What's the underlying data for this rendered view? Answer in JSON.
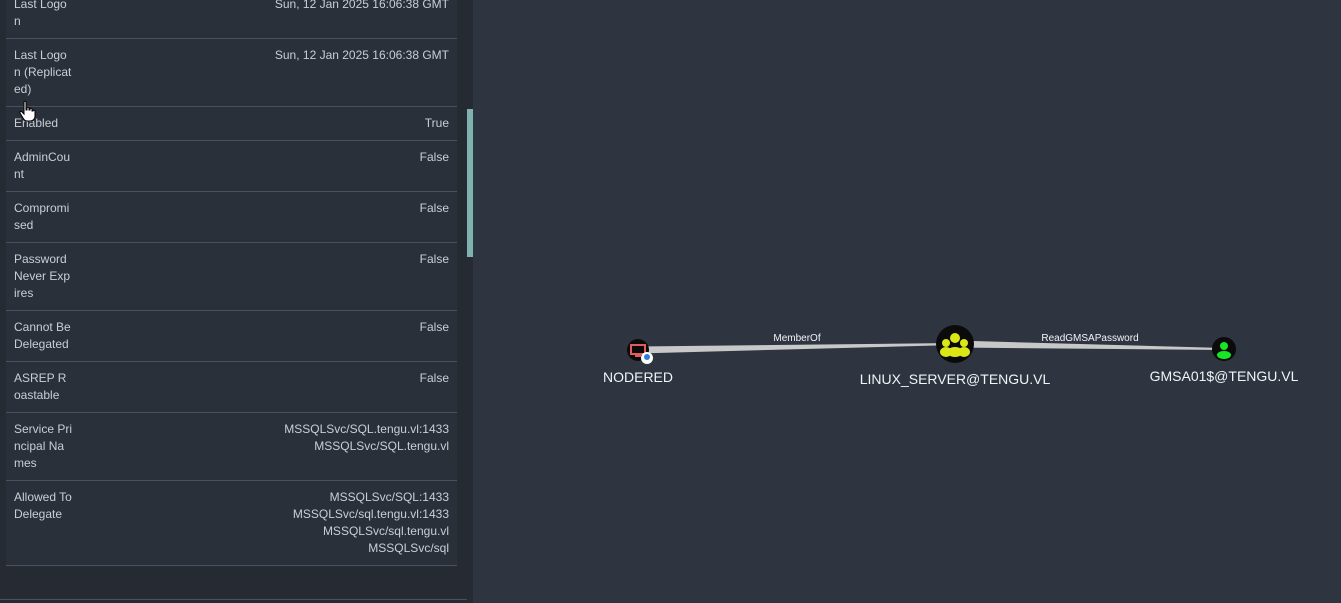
{
  "properties": [
    {
      "label": "Last Logon",
      "values": [
        "Sun, 12 Jan 2025 16:06:38 GMT"
      ]
    },
    {
      "label": "Last Logon (Replicated)",
      "values": [
        "Sun, 12 Jan 2025 16:06:38 GMT"
      ]
    },
    {
      "label": "Enabled",
      "values": [
        "True"
      ]
    },
    {
      "label": "AdminCount",
      "values": [
        "False"
      ]
    },
    {
      "label": "Compromised",
      "values": [
        "False"
      ]
    },
    {
      "label": "Password Never Expires",
      "values": [
        "False"
      ]
    },
    {
      "label": "Cannot Be Delegated",
      "values": [
        "False"
      ]
    },
    {
      "label": "ASREP Roastable",
      "values": [
        "False"
      ]
    },
    {
      "label": "Service Principal Names",
      "values": [
        "MSSQLSvc/SQL.tengu.vl:1433",
        "MSSQLSvc/SQL.tengu.vl"
      ]
    },
    {
      "label": "Allowed To Delegate",
      "values": [
        "MSSQLSvc/SQL:1433",
        "MSSQLSvc/sql.tengu.vl:1433",
        "MSSQLSvc/sql.tengu.vl",
        "MSSQLSvc/sql"
      ]
    }
  ],
  "graph": {
    "nodes": [
      {
        "id": "nodered",
        "label": "NODERED",
        "type": "computer",
        "color": "#e25c5c",
        "icon": "computer-icon"
      },
      {
        "id": "linux_server",
        "label": "LINUX_SERVER@TENGU.VL",
        "type": "group",
        "color": "#dbe617",
        "icon": "group-icon"
      },
      {
        "id": "gmsa01",
        "label": "GMSA01$@TENGU.VL",
        "type": "user",
        "color": "#17e625",
        "icon": "user-icon"
      }
    ],
    "edges": [
      {
        "from": "nodered",
        "to": "linux_server",
        "label": "MemberOf"
      },
      {
        "from": "linux_server",
        "to": "gmsa01",
        "label": "ReadGMSAPassword"
      }
    ]
  },
  "colors": {
    "panel_bg": "#2a303a",
    "graph_bg": "#2e3440",
    "scrollbar": "#7fb3b0",
    "edge": "#c8c8c8"
  }
}
